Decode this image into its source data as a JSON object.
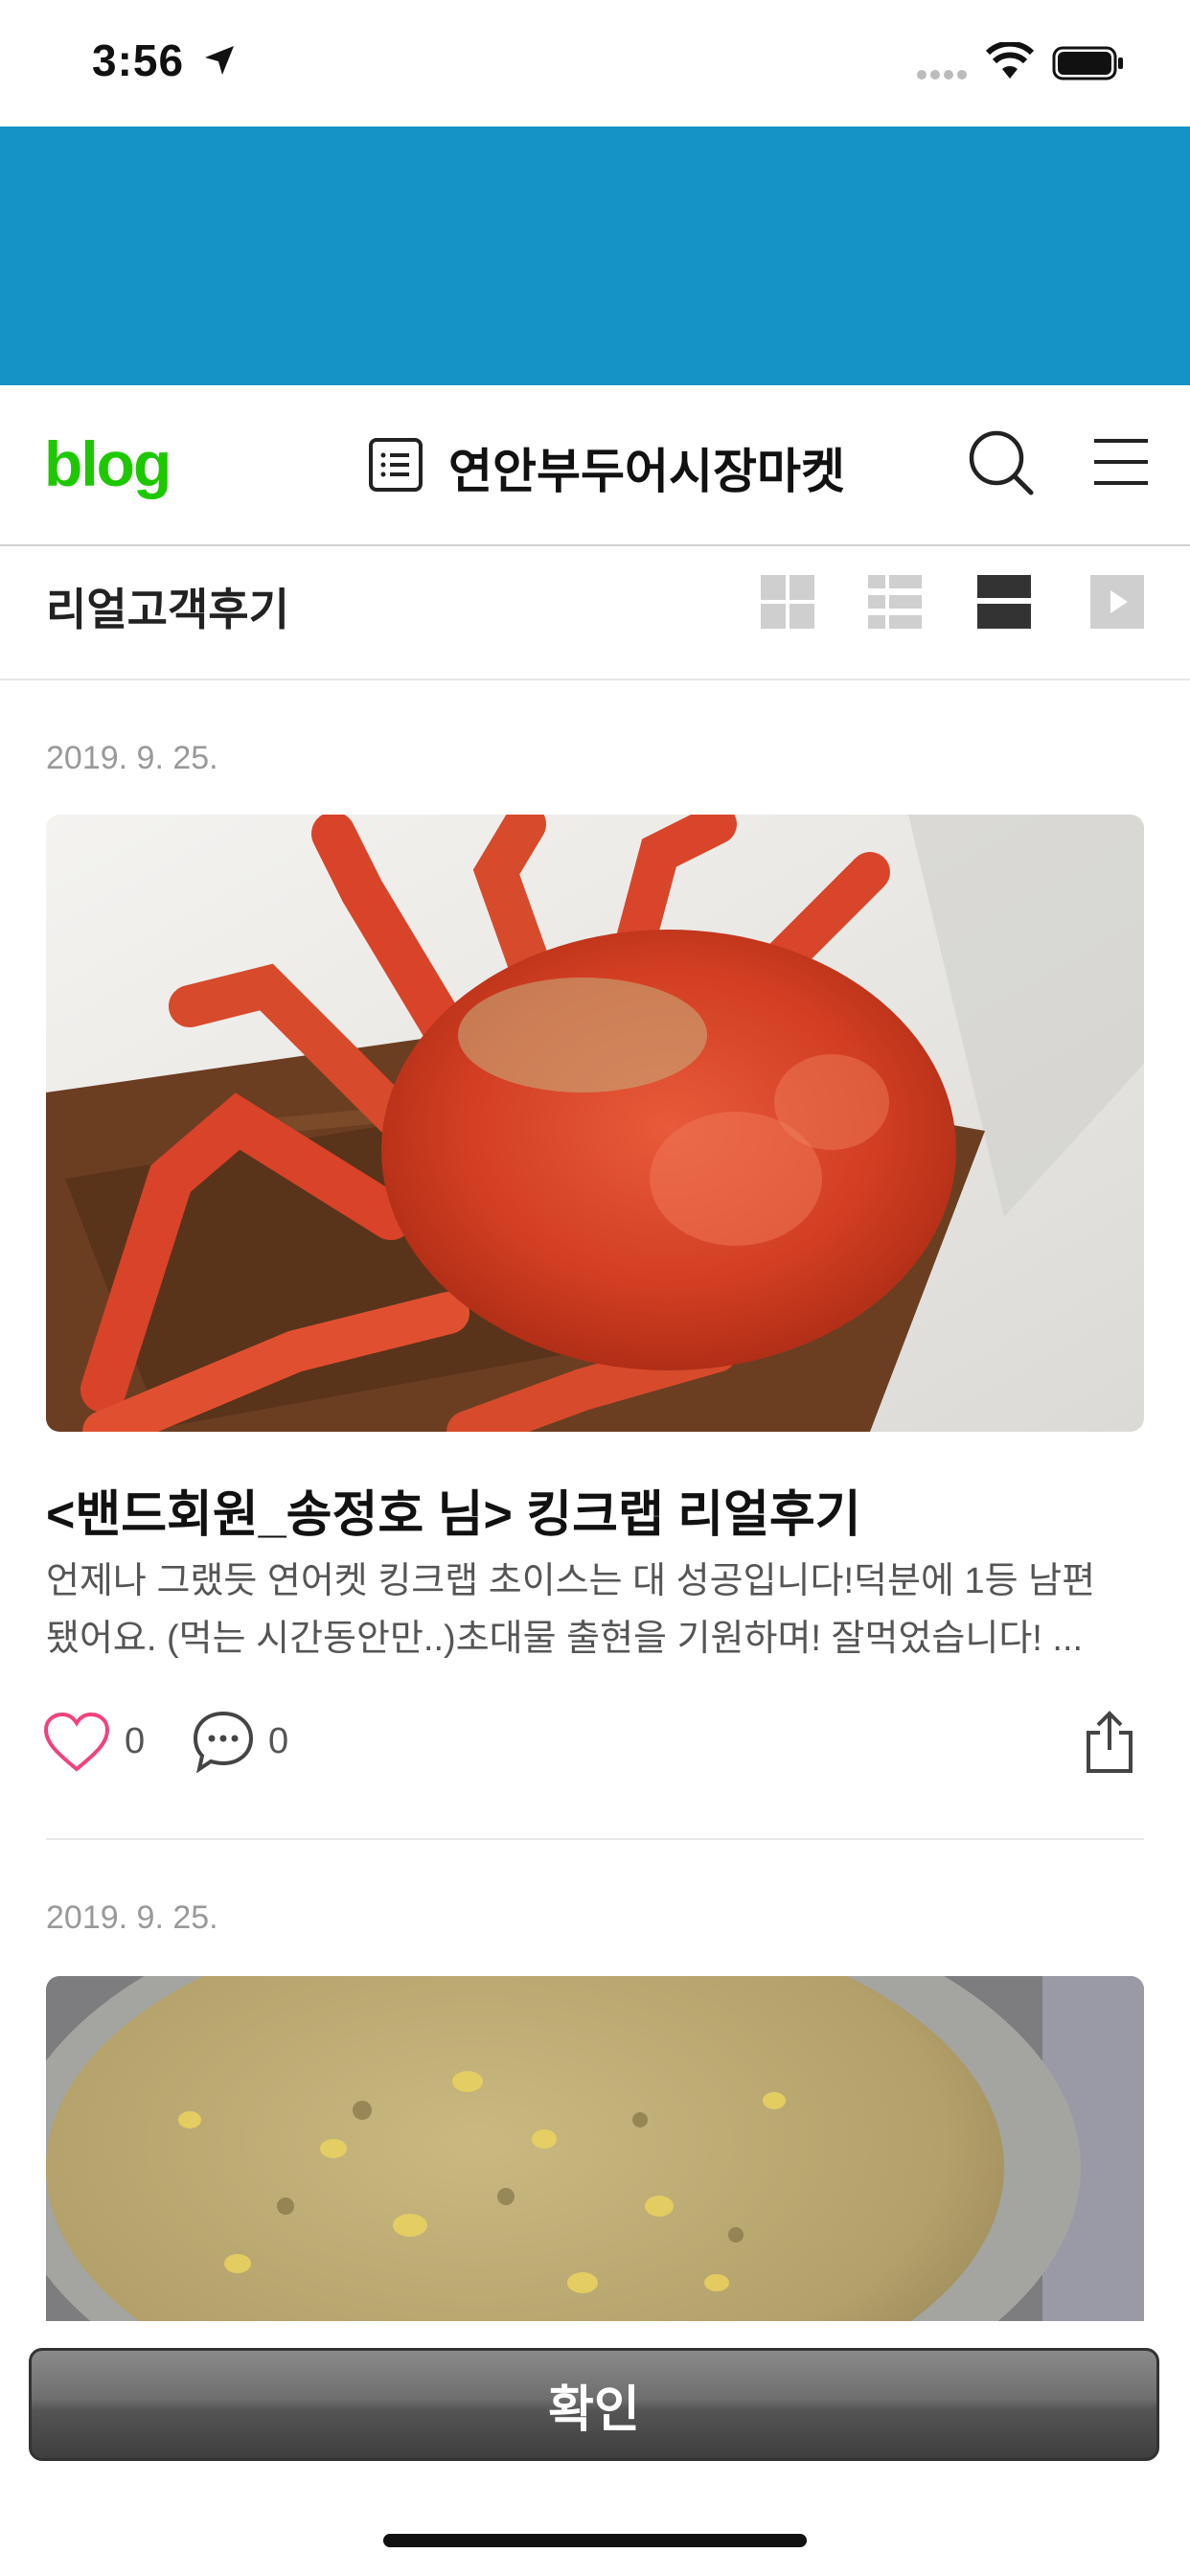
{
  "status_bar": {
    "time": "3:56"
  },
  "blog_header": {
    "logo": "blog",
    "title": "연안부두어시장마켓"
  },
  "category": {
    "title": "리얼고객후기",
    "view_modes": [
      "album-view",
      "list-view",
      "card-view",
      "video-view"
    ],
    "active_view": "card-view"
  },
  "posts": [
    {
      "date": "2019. 9. 25.",
      "title": "<밴드회원_송정호 님> 킹크랩 리얼후기",
      "excerpt_line1": "언제나 그랬듯 연어켓 킹크랩 초이스는 대 성공입니다!덕분에 1등 남편",
      "excerpt_line2": "됐어요. (먹는 시간동안만..)초대물 출현을 기원하며! 잘먹었습니다! ...",
      "likes": "0",
      "comments": "0",
      "image": "king-crab-photo"
    },
    {
      "date": "2019. 9. 25.",
      "image": "porridge-photo"
    }
  ],
  "confirm_button": {
    "label": "확인"
  },
  "colors": {
    "banner": "#1393c6",
    "blog_green": "#1ec800",
    "like_pink": "#f0437a"
  }
}
